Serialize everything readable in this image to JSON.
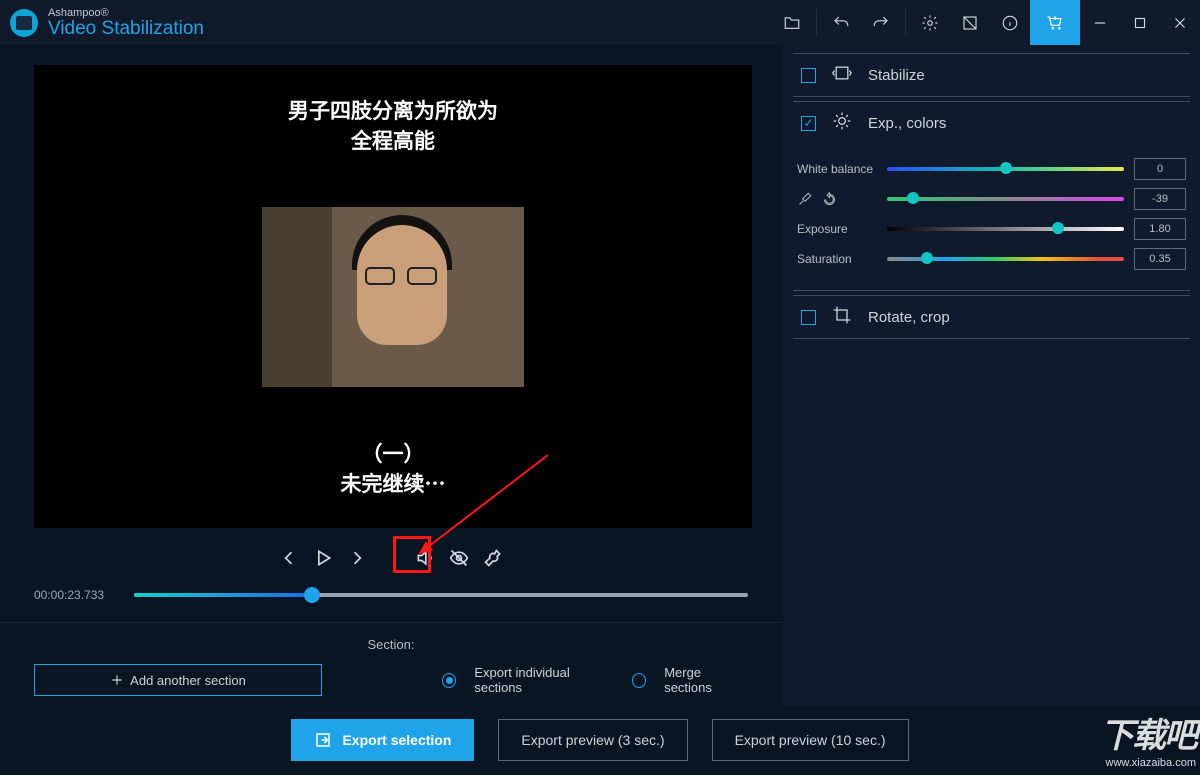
{
  "header": {
    "brand": "Ashampoo®",
    "product": "Video Stabilization"
  },
  "video": {
    "top_text": "男子四肢分离为所欲为\n全程高能",
    "bottom_text": "（一）\n未完继续⋯"
  },
  "timeline": {
    "timecode": "00:00:23.733",
    "progress_pct": 29
  },
  "section": {
    "label": "Section:",
    "add_label": "Add another section",
    "export_individual": "Export individual sections",
    "merge": "Merge sections",
    "selected": "individual"
  },
  "panels": {
    "stabilize": {
      "label": "Stabilize",
      "checked": false
    },
    "exp_colors": {
      "label": "Exp., colors",
      "checked": true
    },
    "rotate": {
      "label": "Rotate, crop",
      "checked": false
    }
  },
  "sliders": {
    "white_balance": {
      "label": "White balance",
      "value": "0",
      "pct": 50
    },
    "tint": {
      "value": "-39",
      "pct": 11
    },
    "exposure": {
      "label": "Exposure",
      "value": "1.80",
      "pct": 72
    },
    "saturation": {
      "label": "Saturation",
      "value": "0.35",
      "pct": 17
    }
  },
  "footer": {
    "export_selection": "Export selection",
    "preview3": "Export preview (3 sec.)",
    "preview10": "Export preview (10 sec.)"
  },
  "watermark": {
    "big": "下载吧",
    "url": "www.xiazaiba.com"
  }
}
